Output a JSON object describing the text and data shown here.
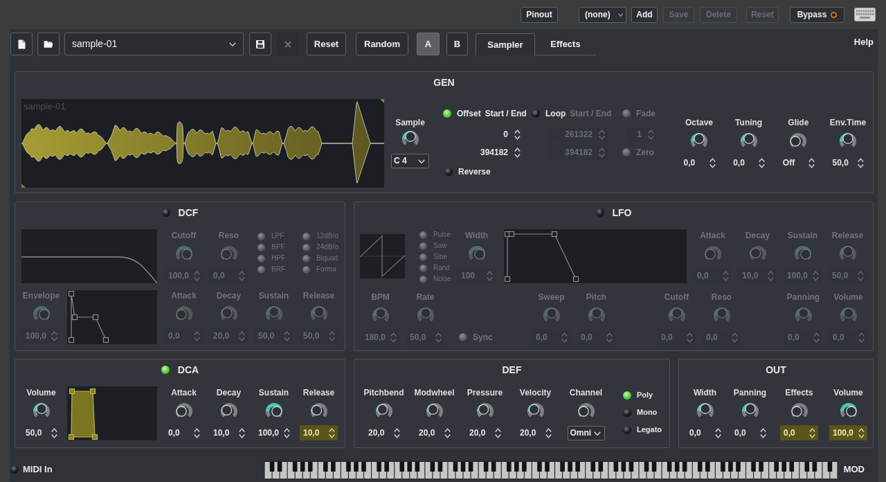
{
  "top_bar": {
    "pinout_button": "Pinout",
    "preset_dropdown": "(none)",
    "buttons": [
      {
        "label": "Add",
        "disabled": false
      },
      {
        "label": "Save",
        "disabled": true
      },
      {
        "label": "Delete",
        "disabled": true
      },
      {
        "label": "Reset",
        "disabled": true
      }
    ],
    "bypass": {
      "label": "Bypass",
      "on": false
    }
  },
  "toolbar": {
    "preset": "sample-01",
    "close_button": {
      "disabled": true
    },
    "buttons": [
      "Reset",
      "Random"
    ],
    "slots": [
      {
        "label": "A",
        "selected": true
      },
      {
        "label": "B",
        "selected": false
      }
    ],
    "tabs": [
      {
        "label": "Sampler",
        "selected": true
      },
      {
        "label": "Effects",
        "selected": false
      }
    ],
    "help": "Help"
  },
  "gen": {
    "title": "GEN",
    "waveform_label": "sample-01",
    "sample": {
      "label": "Sample",
      "level": 0.5,
      "note": "C 4"
    },
    "offset": {
      "label": "Offset",
      "on": true,
      "range_label": "Start / End",
      "start": "0",
      "end": "394182"
    },
    "loop": {
      "label": "Loop",
      "on": false,
      "range_label": "Start / End",
      "start": "261322",
      "end": "394182"
    },
    "fade": {
      "label": "Fade",
      "disabled": true,
      "value": "1"
    },
    "zero": {
      "label": "Zero",
      "disabled": true
    },
    "reverse": {
      "label": "Reverse",
      "on": false
    },
    "knobs": [
      {
        "label": "Octave",
        "value": "0,0",
        "level": 0.5,
        "highlighted": false
      },
      {
        "label": "Tuning",
        "value": "0,0",
        "level": 0.5,
        "highlighted": false
      },
      {
        "label": "Glide",
        "value": "Off",
        "level": 0,
        "highlighted": false
      },
      {
        "label": "Env.Time",
        "value": "50,0",
        "level": 0.5,
        "highlighted": false
      }
    ]
  },
  "dcf": {
    "title": "DCF",
    "on": false,
    "knobs": [
      {
        "label": "Cutoff",
        "value": "100,0",
        "level": 1,
        "highlighted": false
      },
      {
        "label": "Reso",
        "value": "0,0",
        "level": 0,
        "highlighted": false
      }
    ],
    "filter_types": [
      "LPF",
      "BPF",
      "HPF",
      "BRF"
    ],
    "slopes": [
      "12dB/o",
      "24dB/o",
      "Biquad",
      "Forma"
    ],
    "envelope_knob": {
      "label": "Envelope",
      "value": "100,0",
      "level": 1,
      "highlighted": false
    },
    "env_knobs": [
      {
        "label": "Attack",
        "value": "0,0",
        "level": 0,
        "highlighted": false
      },
      {
        "label": "Decay",
        "value": "20,0",
        "level": 0.1,
        "highlighted": false
      },
      {
        "label": "Sustain",
        "value": "50,0",
        "level": 0.5,
        "highlighted": false
      },
      {
        "label": "Release",
        "value": "50,0",
        "level": 0.5,
        "highlighted": false
      }
    ]
  },
  "lfo": {
    "title": "LFO",
    "on": false,
    "waveforms": [
      "Pulse",
      "Saw",
      "Sine",
      "Rand",
      "Noise"
    ],
    "width_knob": {
      "label": "Width",
      "value": "100",
      "level": 1,
      "highlighted": false
    },
    "env_knobs": [
      {
        "label": "Attack",
        "value": "0,0",
        "level": 0,
        "highlighted": false
      },
      {
        "label": "Decay",
        "value": "10,0",
        "level": 0.05,
        "highlighted": false
      },
      {
        "label": "Sustain",
        "value": "100,0",
        "level": 1,
        "highlighted": false
      },
      {
        "label": "Release",
        "value": "50,0",
        "level": 0.5,
        "highlighted": false
      }
    ],
    "rate_knobs": [
      {
        "label": "BPM",
        "value": "180,0",
        "level": 0.5,
        "highlighted": false
      },
      {
        "label": "Rate",
        "value": "50,0",
        "level": 0.5,
        "highlighted": false
      }
    ],
    "sync": {
      "label": "Sync",
      "on": false
    },
    "pitch_knobs": [
      {
        "label": "Sweep",
        "value": "0,0",
        "level": 0.5,
        "highlighted": false
      },
      {
        "label": "Pitch",
        "value": "0,0",
        "level": 0.5,
        "highlighted": false
      }
    ],
    "filter_knobs": [
      {
        "label": "Cutoff",
        "value": "0,0",
        "level": 0.5,
        "highlighted": false
      },
      {
        "label": "Reso",
        "value": "0,0",
        "level": 0.5,
        "highlighted": false
      }
    ],
    "amp_knobs": [
      {
        "label": "Panning",
        "value": "0,0",
        "level": 0.5,
        "highlighted": false
      },
      {
        "label": "Volume",
        "value": "0,0",
        "level": 0.5,
        "highlighted": false
      }
    ]
  },
  "dca": {
    "title": "DCA",
    "on": true,
    "volume_knob": {
      "label": "Volume",
      "value": "50,0",
      "level": 0.5,
      "highlighted": false
    },
    "env_knobs": [
      {
        "label": "Attack",
        "value": "0,0",
        "level": 0,
        "highlighted": false
      },
      {
        "label": "Decay",
        "value": "10,0",
        "level": 0.05,
        "highlighted": false
      },
      {
        "label": "Sustain",
        "value": "100,0",
        "level": 1,
        "highlighted": false
      },
      {
        "label": "Release",
        "value": "10,0",
        "level": 0.05,
        "highlighted": true
      }
    ]
  },
  "def": {
    "title": "DEF",
    "knobs": [
      {
        "label": "Pitchbend",
        "value": "20,0",
        "level": 0.17,
        "highlighted": false
      },
      {
        "label": "Modwheel",
        "value": "20,0",
        "level": 0.17,
        "highlighted": false
      },
      {
        "label": "Pressure",
        "value": "20,0",
        "level": 0.17,
        "highlighted": false
      },
      {
        "label": "Velocity",
        "value": "20,0",
        "level": 0.17,
        "highlighted": false
      }
    ],
    "channel": {
      "label": "Channel",
      "level": 0,
      "value": "Omni"
    },
    "modes": [
      {
        "label": "Poly",
        "on": true
      },
      {
        "label": "Mono",
        "on": false
      },
      {
        "label": "Legato",
        "on": false
      }
    ]
  },
  "out": {
    "title": "OUT",
    "knobs": [
      {
        "label": "Width",
        "value": "0,0",
        "level": 0.5,
        "highlighted": false
      },
      {
        "label": "Panning",
        "value": "0,0",
        "level": 0.5,
        "highlighted": false
      },
      {
        "label": "Effects",
        "value": "0,0",
        "level": 0,
        "highlighted": true
      },
      {
        "label": "Volume",
        "value": "100,0",
        "level": 1,
        "highlighted": true
      }
    ]
  },
  "footer": {
    "midi_in": {
      "label": "MIDI In",
      "on": false
    },
    "mod_label": "MOD"
  }
}
